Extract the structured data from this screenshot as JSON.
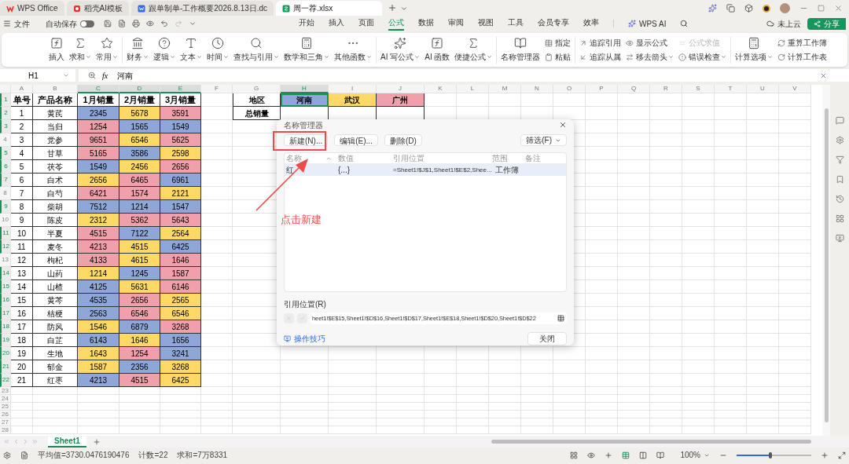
{
  "title_tabs": [
    {
      "label": "WPS Office",
      "kind": "home",
      "selected": false
    },
    {
      "label": "稻壳AI模板",
      "kind": "template",
      "selected": false
    },
    {
      "label": "跟单制单-工作概要2026.8.13日.dc",
      "kind": "doc",
      "selected": false
    },
    {
      "label": "周一荐.xlsx",
      "kind": "sheet",
      "selected": true
    }
  ],
  "menu": {
    "file": "文件",
    "autosave": {
      "label": "自动保存",
      "on": false
    },
    "tabs": [
      {
        "label": "开始",
        "selected": false
      },
      {
        "label": "插入",
        "selected": false
      },
      {
        "label": "页面",
        "selected": false
      },
      {
        "label": "公式",
        "selected": true
      },
      {
        "label": "数据",
        "selected": false
      },
      {
        "label": "审阅",
        "selected": false
      },
      {
        "label": "视图",
        "selected": false
      },
      {
        "label": "工具",
        "selected": false
      },
      {
        "label": "会员专享",
        "selected": false
      },
      {
        "label": "效率",
        "selected": false
      }
    ],
    "ai": "WPS AI",
    "cloud": "未上云",
    "share": "分享"
  },
  "ribbon": {
    "groups": [
      {
        "items": [
          {
            "label": "插入",
            "kind": "large",
            "dropdown": false,
            "disabled": false
          },
          {
            "label": "求和",
            "kind": "large",
            "dropdown": true,
            "disabled": false
          },
          {
            "label": "常用",
            "kind": "large",
            "dropdown": true,
            "disabled": false
          }
        ]
      },
      {
        "items": [
          {
            "label": "财务",
            "kind": "large",
            "dropdown": true,
            "disabled": false
          },
          {
            "label": "逻辑",
            "kind": "large",
            "dropdown": true,
            "disabled": false
          },
          {
            "label": "文本",
            "kind": "large",
            "dropdown": true,
            "disabled": false
          },
          {
            "label": "时间",
            "kind": "large",
            "dropdown": true,
            "disabled": false
          },
          {
            "label": "查找与引用",
            "kind": "large",
            "dropdown": true,
            "disabled": false
          },
          {
            "label": "数学和三角",
            "kind": "large",
            "dropdown": true,
            "disabled": false
          },
          {
            "label": "其他函数",
            "kind": "large",
            "dropdown": true,
            "disabled": false
          }
        ]
      },
      {
        "items": [
          {
            "label": "AI 写公式",
            "kind": "large",
            "dropdown": true,
            "disabled": false
          },
          {
            "label": "AI 函数",
            "kind": "large",
            "dropdown": false,
            "disabled": false
          },
          {
            "label": "便捷公式",
            "kind": "large",
            "dropdown": true,
            "disabled": false
          }
        ]
      },
      {
        "items": [
          {
            "label": "名称管理器",
            "kind": "large",
            "dropdown": false,
            "disabled": false
          },
          {
            "label": "指定",
            "kind": "small",
            "dropdown": false,
            "disabled": false
          },
          {
            "label": "粘贴",
            "kind": "small",
            "dropdown": false,
            "disabled": false
          }
        ]
      },
      {
        "items": [
          {
            "label": "追踪引用",
            "kind": "small",
            "dropdown": false,
            "disabled": false
          },
          {
            "label": "追踪从属",
            "kind": "small",
            "dropdown": false,
            "disabled": false
          },
          {
            "label": "显示公式",
            "kind": "small",
            "dropdown": false,
            "disabled": false
          },
          {
            "label": "移去箭头",
            "kind": "small",
            "dropdown": true,
            "disabled": false
          },
          {
            "label": "公式求值",
            "kind": "small",
            "dropdown": false,
            "disabled": true
          },
          {
            "label": "错误检查",
            "kind": "small",
            "dropdown": true,
            "disabled": false
          }
        ]
      },
      {
        "items": [
          {
            "label": "计算选项",
            "kind": "large",
            "dropdown": true,
            "disabled": false
          },
          {
            "label": "重算工作簿",
            "kind": "small",
            "dropdown": false,
            "disabled": false
          },
          {
            "label": "计算工作表",
            "kind": "small",
            "dropdown": false,
            "disabled": false
          }
        ]
      }
    ]
  },
  "formula_bar": {
    "cell": "H1",
    "fx": "fx",
    "value": "河南"
  },
  "sheet": {
    "columns": [
      {
        "label": "A",
        "selected": false
      },
      {
        "label": "B",
        "selected": false
      },
      {
        "label": "C",
        "selected": true
      },
      {
        "label": "D",
        "selected": true
      },
      {
        "label": "E",
        "selected": true
      },
      {
        "label": "F",
        "selected": false
      },
      {
        "label": "G",
        "selected": false
      },
      {
        "label": "H",
        "selected": true
      },
      {
        "label": "I",
        "selected": false
      },
      {
        "label": "J",
        "selected": false
      },
      {
        "label": "K",
        "selected": false
      },
      {
        "label": "L",
        "selected": false
      },
      {
        "label": "M",
        "selected": false
      },
      {
        "label": "N",
        "selected": false
      },
      {
        "label": "O",
        "selected": false
      },
      {
        "label": "P",
        "selected": false
      },
      {
        "label": "Q",
        "selected": false
      },
      {
        "label": "R",
        "selected": false
      },
      {
        "label": "S",
        "selected": false
      },
      {
        "label": "T",
        "selected": false
      },
      {
        "label": "U",
        "selected": false
      },
      {
        "label": "V",
        "selected": false
      }
    ],
    "rows": [
      {
        "label": "1",
        "selected": true
      },
      {
        "label": "2",
        "selected": true
      },
      {
        "label": "3",
        "selected": true
      },
      {
        "label": "4",
        "selected": false
      },
      {
        "label": "5",
        "selected": true
      },
      {
        "label": "6",
        "selected": true
      },
      {
        "label": "7",
        "selected": true
      },
      {
        "label": "8",
        "selected": false
      },
      {
        "label": "9",
        "selected": true
      },
      {
        "label": "10",
        "selected": false
      },
      {
        "label": "11",
        "selected": true
      },
      {
        "label": "12",
        "selected": true
      },
      {
        "label": "13",
        "selected": false
      },
      {
        "label": "14",
        "selected": true
      },
      {
        "label": "15",
        "selected": true
      },
      {
        "label": "16",
        "selected": true
      },
      {
        "label": "17",
        "selected": true
      },
      {
        "label": "18",
        "selected": true
      },
      {
        "label": "19",
        "selected": true
      },
      {
        "label": "20",
        "selected": true
      },
      {
        "label": "21",
        "selected": true
      },
      {
        "label": "22",
        "selected": true
      },
      {
        "label": "23",
        "selected": false
      },
      {
        "label": "24",
        "selected": false
      },
      {
        "label": "25",
        "selected": false
      },
      {
        "label": "26",
        "selected": false
      },
      {
        "label": "27",
        "selected": false
      },
      {
        "label": "28",
        "selected": false
      }
    ],
    "header": [
      "单号",
      "产品名称",
      "1月销量",
      "2月销量",
      "3月销量"
    ],
    "records": [
      {
        "no": "1",
        "name": "黄芪",
        "sales": [
          {
            "value": "2345",
            "color": "#8ea6d8"
          },
          {
            "value": "5678",
            "color": "#ffd966"
          },
          {
            "value": "3591",
            "color": "#f0a0aa"
          }
        ]
      },
      {
        "no": "2",
        "name": "当归",
        "sales": [
          {
            "value": "1254",
            "color": "#f0a0aa"
          },
          {
            "value": "1565",
            "color": "#8ea6d8"
          },
          {
            "value": "1549",
            "color": "#8ea6d8"
          }
        ]
      },
      {
        "no": "3",
        "name": "党参",
        "sales": [
          {
            "value": "9651",
            "color": "#f0a0aa"
          },
          {
            "value": "6546",
            "color": "#ffd966"
          },
          {
            "value": "5625",
            "color": "#f0a0aa"
          }
        ]
      },
      {
        "no": "4",
        "name": "甘草",
        "sales": [
          {
            "value": "5165",
            "color": "#f0a0aa"
          },
          {
            "value": "3586",
            "color": "#8ea6d8"
          },
          {
            "value": "2598",
            "color": "#ffd966"
          }
        ]
      },
      {
        "no": "5",
        "name": "茯苓",
        "sales": [
          {
            "value": "1549",
            "color": "#8ea6d8"
          },
          {
            "value": "2456",
            "color": "#ffd966"
          },
          {
            "value": "2656",
            "color": "#f0a0aa"
          }
        ]
      },
      {
        "no": "6",
        "name": "白术",
        "sales": [
          {
            "value": "2656",
            "color": "#ffd966"
          },
          {
            "value": "6465",
            "color": "#f0a0aa"
          },
          {
            "value": "6961",
            "color": "#8ea6d8"
          }
        ]
      },
      {
        "no": "7",
        "name": "白芍",
        "sales": [
          {
            "value": "6421",
            "color": "#f0a0aa"
          },
          {
            "value": "1574",
            "color": "#f0a0aa"
          },
          {
            "value": "2121",
            "color": "#ffd966"
          }
        ]
      },
      {
        "no": "8",
        "name": "柴胡",
        "sales": [
          {
            "value": "7512",
            "color": "#8ea6d8"
          },
          {
            "value": "1214",
            "color": "#8ea6d8"
          },
          {
            "value": "1547",
            "color": "#8ea6d8"
          }
        ]
      },
      {
        "no": "9",
        "name": "陈皮",
        "sales": [
          {
            "value": "2312",
            "color": "#ffd966"
          },
          {
            "value": "5362",
            "color": "#f0a0aa"
          },
          {
            "value": "5643",
            "color": "#f0a0aa"
          }
        ]
      },
      {
        "no": "10",
        "name": "半夏",
        "sales": [
          {
            "value": "4515",
            "color": "#f0a0aa"
          },
          {
            "value": "7122",
            "color": "#8ea6d8"
          },
          {
            "value": "2564",
            "color": "#ffd966"
          }
        ]
      },
      {
        "no": "11",
        "name": "麦冬",
        "sales": [
          {
            "value": "4213",
            "color": "#f0a0aa"
          },
          {
            "value": "4515",
            "color": "#ffd966"
          },
          {
            "value": "6425",
            "color": "#8ea6d8"
          }
        ]
      },
      {
        "no": "12",
        "name": "枸杞",
        "sales": [
          {
            "value": "4133",
            "color": "#f0a0aa"
          },
          {
            "value": "4615",
            "color": "#ffd966"
          },
          {
            "value": "1646",
            "color": "#f0a0aa"
          }
        ]
      },
      {
        "no": "13",
        "name": "山药",
        "sales": [
          {
            "value": "1214",
            "color": "#ffd966"
          },
          {
            "value": "1245",
            "color": "#8ea6d8"
          },
          {
            "value": "1587",
            "color": "#f0a0aa"
          }
        ]
      },
      {
        "no": "14",
        "name": "山楂",
        "sales": [
          {
            "value": "4125",
            "color": "#8ea6d8"
          },
          {
            "value": "5631",
            "color": "#ffd966"
          },
          {
            "value": "6146",
            "color": "#f0a0aa"
          }
        ]
      },
      {
        "no": "15",
        "name": "黄芩",
        "sales": [
          {
            "value": "4535",
            "color": "#8ea6d8"
          },
          {
            "value": "2656",
            "color": "#f0a0aa"
          },
          {
            "value": "2565",
            "color": "#ffd966"
          }
        ]
      },
      {
        "no": "16",
        "name": "桔梗",
        "sales": [
          {
            "value": "2563",
            "color": "#8ea6d8"
          },
          {
            "value": "6546",
            "color": "#f0a0aa"
          },
          {
            "value": "6546",
            "color": "#ffd966"
          }
        ]
      },
      {
        "no": "17",
        "name": "防风",
        "sales": [
          {
            "value": "1546",
            "color": "#ffd966"
          },
          {
            "value": "6879",
            "color": "#8ea6d8"
          },
          {
            "value": "3268",
            "color": "#f0a0aa"
          }
        ]
      },
      {
        "no": "18",
        "name": "白芷",
        "sales": [
          {
            "value": "6143",
            "color": "#8ea6d8"
          },
          {
            "value": "1646",
            "color": "#ffd966"
          },
          {
            "value": "1656",
            "color": "#8ea6d8"
          }
        ]
      },
      {
        "no": "19",
        "name": "生地",
        "sales": [
          {
            "value": "1643",
            "color": "#ffd966"
          },
          {
            "value": "1254",
            "color": "#f0a0aa"
          },
          {
            "value": "3241",
            "color": "#8ea6d8"
          }
        ]
      },
      {
        "no": "20",
        "name": "郁金",
        "sales": [
          {
            "value": "1587",
            "color": "#ffd966"
          },
          {
            "value": "2356",
            "color": "#8ea6d8"
          },
          {
            "value": "3268",
            "color": "#ffd966"
          }
        ]
      },
      {
        "no": "21",
        "name": "红枣",
        "sales": [
          {
            "value": "4213",
            "color": "#8ea6d8"
          },
          {
            "value": "4515",
            "color": "#f0a0aa"
          },
          {
            "value": "6425",
            "color": "#ffd966"
          }
        ]
      }
    ],
    "region": {
      "label": "地区",
      "total_label": "总销量",
      "items": [
        {
          "label": "河南",
          "color": "#8ea6d8",
          "selected": true
        },
        {
          "label": "武汉",
          "color": "#ffd966",
          "selected": false
        },
        {
          "label": "广州",
          "color": "#f0a0aa",
          "selected": false
        }
      ]
    }
  },
  "dialog": {
    "title": "名称管理器",
    "buttons": [
      "新建(N)...",
      "编辑(E)...",
      "删除(D)"
    ],
    "filter": "筛选(F)",
    "columns": [
      "名称",
      "数值",
      "引用位置",
      "范围",
      "备注"
    ],
    "rows": [
      {
        "name": "红",
        "value": "{...}",
        "ref": "=Sheet1!$J$1,Sheet1!$E$2,Shee...",
        "scope": "工作簿",
        "selected": true
      }
    ],
    "ref_label": "引用位置(R)",
    "ref_value": "heet1!$E$15,Sheet1!$D$16,Sheet1!$D$17,Sheet1!$E$18,Sheet1!$D$20,Sheet1!$D$22",
    "tips": "操作技巧",
    "close": "关闭"
  },
  "annotation": {
    "text": "点击新建"
  },
  "sheet_tabs": [
    {
      "label": "Sheet1",
      "selected": true
    }
  ],
  "status": {
    "average": "平均值=3730.0476190476",
    "count": "计数=22",
    "sum": "求和=7万8331",
    "zoom": "100%",
    "zoom_slider": {
      "level": 0.45
    }
  }
}
